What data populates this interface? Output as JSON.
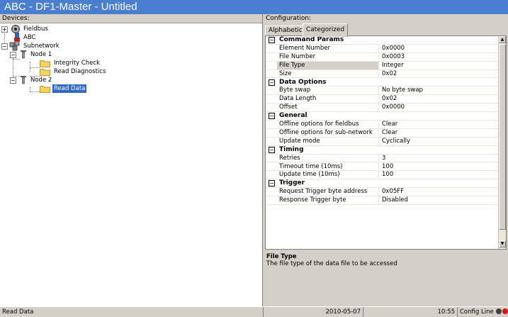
{
  "window": {
    "title": "ABC - DF1-Master - Untitled"
  },
  "devices": {
    "label": "Devices:",
    "tree": {
      "fieldbus": "Fieldbus",
      "abc": "ABC",
      "subnetwork": "Subnetwork",
      "node1": "Node 1",
      "integrity_check": "Integrity Check",
      "read_diagnostics": "Read Diagnostics",
      "node2": "Node 2",
      "read_data": "Read Data"
    },
    "expander_plus": "+",
    "expander_minus": "−"
  },
  "configuration": {
    "label": "Configuration:",
    "tabs": [
      "Alphabetic",
      "Categorized"
    ],
    "active_tab": "Categorized",
    "collapse_symbol": "−",
    "categories": [
      {
        "name": "Command Params",
        "rows": [
          {
            "name": "Element Number",
            "value": "0x0000"
          },
          {
            "name": "File Number",
            "value": "0x0003"
          },
          {
            "name": "File Type",
            "value": "Integer"
          },
          {
            "name": "Size",
            "value": "0x02"
          }
        ]
      },
      {
        "name": "Data Options",
        "rows": [
          {
            "name": "Byte swap",
            "value": "No byte swap"
          },
          {
            "name": "Data Length",
            "value": "0x02"
          },
          {
            "name": "Offset",
            "value": "0x0000"
          }
        ]
      },
      {
        "name": "General",
        "rows": [
          {
            "name": "Offline options for fieldbus",
            "value": "Clear"
          },
          {
            "name": "Offline options for sub-network",
            "value": "Clear"
          },
          {
            "name": "Update mode",
            "value": "Cyclically"
          }
        ]
      },
      {
        "name": "Timing",
        "rows": [
          {
            "name": "Retries",
            "value": "3"
          },
          {
            "name": "Timeout time (10ms)",
            "value": "100"
          },
          {
            "name": "Update time (10ms)",
            "value": "100"
          }
        ]
      },
      {
        "name": "Trigger",
        "rows": [
          {
            "name": "Request Trigger byte address",
            "value": "0x05FF"
          },
          {
            "name": "Response Trigger byte",
            "value": "Disabled"
          }
        ]
      }
    ],
    "selected_row": "File Type",
    "description": {
      "title": "File Type",
      "text": "The file type of the data file to be accessed"
    },
    "scroll_up": "▲",
    "scroll_down": "▼"
  },
  "status_bar": {
    "selection": "Read Data",
    "date": "2010-05-07",
    "time": "10:55",
    "mode": "Config Line",
    "led_colors": [
      "#404040",
      "#d01818"
    ]
  },
  "colors": {
    "titlebar": "#4a7fd0",
    "selection": "#316ac5",
    "folder": "#f4d35e"
  },
  "icons": [
    "fieldbus-icon",
    "abc-device-icon",
    "subnetwork-icon",
    "node-icon",
    "folder-icon",
    "led-icon"
  ]
}
